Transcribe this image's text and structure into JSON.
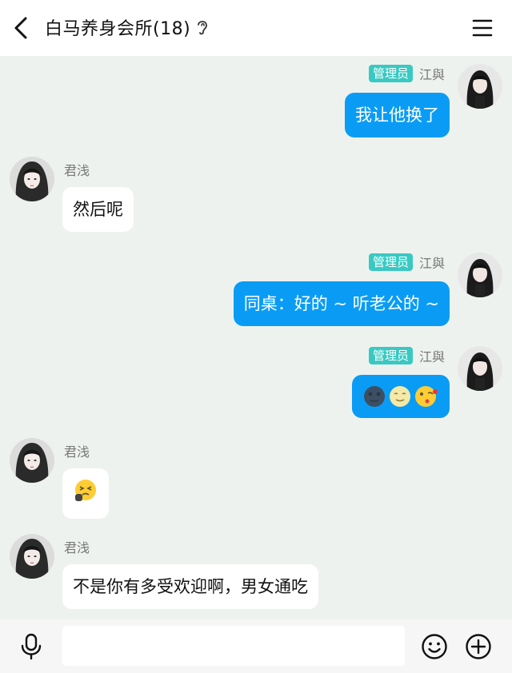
{
  "header": {
    "title": "白马养身会所(18)",
    "icons": [
      "back-arrow-icon",
      "ear-icon",
      "menu-icon"
    ]
  },
  "messages": [
    {
      "side": "me",
      "role_badge": "管理员",
      "sender": "江與",
      "text": "我让他换了"
    },
    {
      "side": "them",
      "sender": "君浅",
      "text": "然后呢"
    },
    {
      "side": "me",
      "role_badge": "管理员",
      "sender": "江與",
      "text": "同桌：好的 ~ 听老公的 ~"
    },
    {
      "side": "me",
      "role_badge": "管理员",
      "sender": "江與",
      "emojis": [
        "dark-moon-face",
        "smiling-moon-face",
        "kiss-face"
      ]
    },
    {
      "side": "them",
      "sender": "君浅",
      "emojis": [
        "persevering-face"
      ]
    },
    {
      "side": "them",
      "sender": "君浅",
      "text": "不是你有多受欢迎啊，男女通吃"
    }
  ],
  "input_bar": {
    "placeholder": "",
    "icons": [
      "microphone-icon",
      "smiley-icon",
      "plus-circle-icon"
    ]
  },
  "colors": {
    "my_bubble": "#0a9cf5",
    "their_bubble": "#ffffff",
    "badge": "#39c9c2",
    "background": "#eef2ee"
  }
}
